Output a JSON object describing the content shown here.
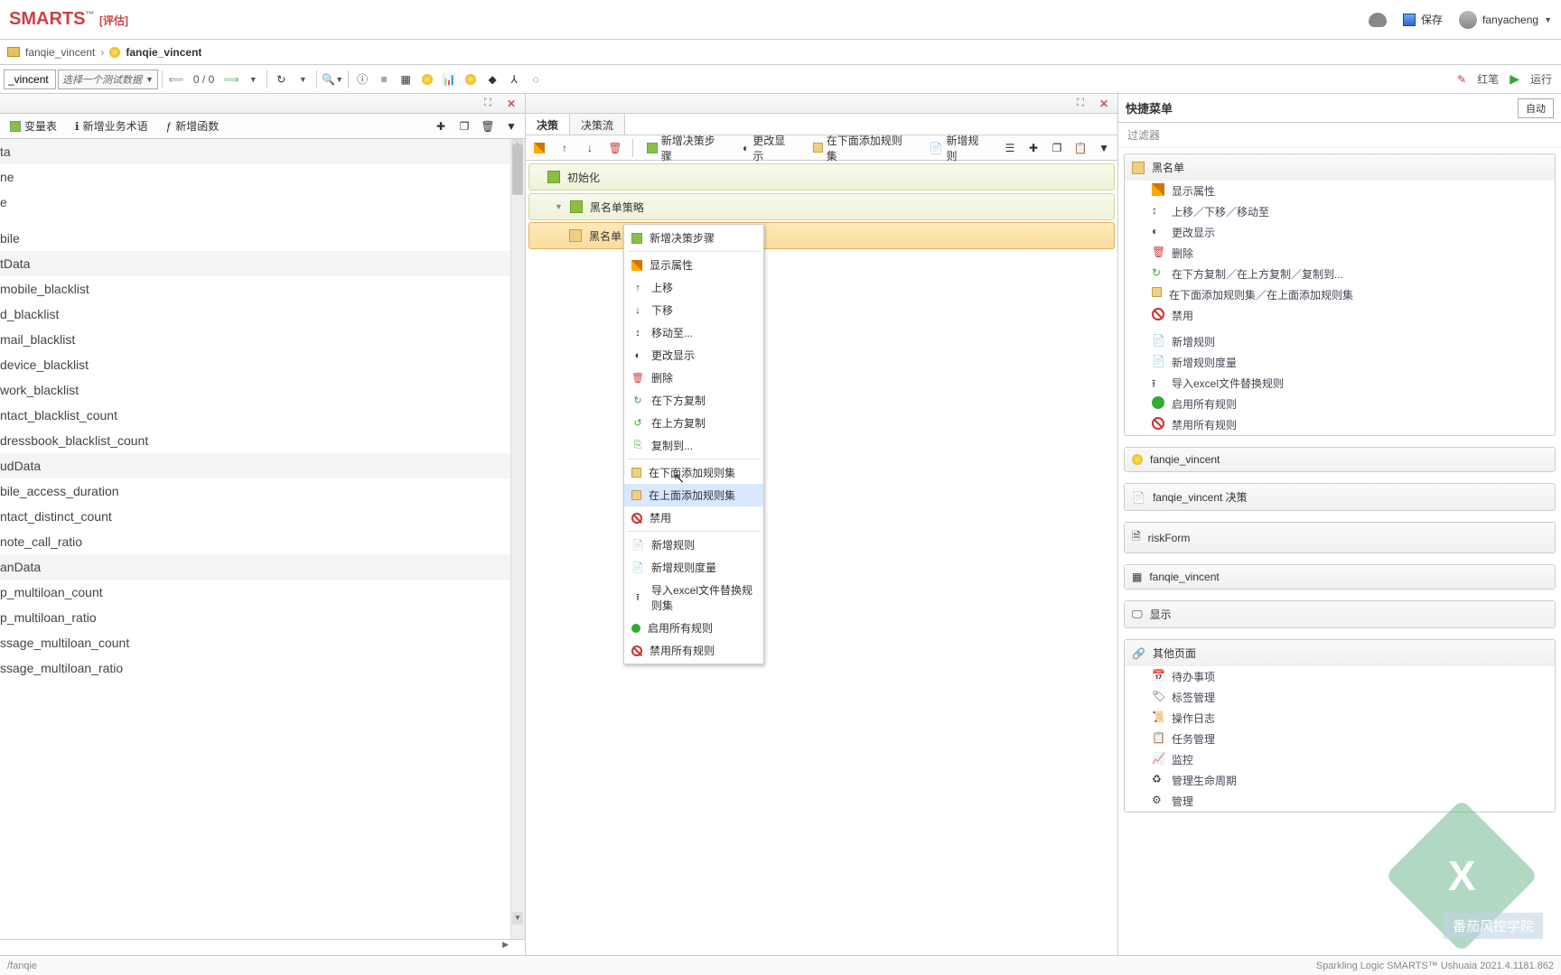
{
  "header": {
    "logo_text": "SMARTS",
    "logo_tm": "™",
    "logo_tag": "[评估]",
    "save_label": "保存",
    "username": "fanyacheng"
  },
  "breadcrumb": {
    "item1": "fanqie_vincent",
    "item2": "fanqie_vincent"
  },
  "toolbar": {
    "input_value": "_vincent",
    "select_placeholder": "选择一个测试数据",
    "pager": "0 / 0",
    "redpen": "红笔",
    "run": "运行"
  },
  "left": {
    "btn_vartable": "变量表",
    "btn_bizrule": "新增业务术语",
    "btn_addfunc": "新增函数",
    "items": [
      {
        "text": "ta",
        "group": true
      },
      {
        "text": "ne",
        "group": false
      },
      {
        "text": "e",
        "group": false
      },
      {
        "text": "",
        "group": false
      },
      {
        "text": "bile",
        "group": false
      },
      {
        "text": "tData",
        "group": true
      },
      {
        "text": "mobile_blacklist",
        "group": false
      },
      {
        "text": "d_blacklist",
        "group": false
      },
      {
        "text": "mail_blacklist",
        "group": false
      },
      {
        "text": "device_blacklist",
        "group": false
      },
      {
        "text": "work_blacklist",
        "group": false
      },
      {
        "text": "ntact_blacklist_count",
        "group": false
      },
      {
        "text": "dressbook_blacklist_count",
        "group": false
      },
      {
        "text": "udData",
        "group": true
      },
      {
        "text": "bile_access_duration",
        "group": false
      },
      {
        "text": "ntact_distinct_count",
        "group": false
      },
      {
        "text": "note_call_ratio",
        "group": false
      },
      {
        "text": "anData",
        "group": true
      },
      {
        "text": "p_multiloan_count",
        "group": false
      },
      {
        "text": "p_multiloan_ratio",
        "group": false
      },
      {
        "text": "ssage_multiloan_count",
        "group": false
      },
      {
        "text": "ssage_multiloan_ratio",
        "group": false
      }
    ]
  },
  "mid": {
    "tab1": "决策",
    "tab2": "决策流",
    "btn_new_step": "新增决策步骤",
    "btn_change_disp": "更改显示",
    "btn_add_ruleset_below": "在下面添加规则集",
    "btn_new_rule": "新增规则",
    "tree": {
      "n1": "初始化",
      "n2": "黑名单策略",
      "n3": "黑名单"
    }
  },
  "ctx": {
    "new_step": "新增决策步骤",
    "show_attr": "显示属性",
    "move_up": "上移",
    "move_down": "下移",
    "move_to": "移动至...",
    "change_disp": "更改显示",
    "delete": "删除",
    "copy_below": "在下方复制",
    "copy_above": "在上方复制",
    "copy_to": "复制到...",
    "add_ruleset_below": "在下面添加规则集",
    "add_ruleset_above": "在上面添加规则集",
    "disable": "禁用",
    "new_rule": "新增规则",
    "new_rule_var": "新增规则度量",
    "import_excel": "导入excel文件替换规则集",
    "enable_all": "启用所有规则",
    "disable_all": "禁用所有规则"
  },
  "right": {
    "title": "快捷菜单",
    "auto": "自动",
    "filter": "过滤器",
    "block1_title": "黑名单",
    "links1": {
      "show_attr": "显示属性",
      "move": "上移／下移／移动至",
      "change_disp": "更改显示",
      "delete": "删除",
      "copy": "在下方复制／在上方复制／复制到...",
      "add_ruleset": "在下面添加规则集／在上面添加规则集",
      "disable": "禁用",
      "new_rule": "新增规则",
      "new_rule_var": "新增规则度量",
      "import_excel": "导入excel文件替换规则",
      "enable_all": "启用所有规则",
      "disable_all": "禁用所有规则"
    },
    "block2": "fanqie_vincent",
    "block3": "fanqie_vincent 决策",
    "block4": "riskForm",
    "block5": "fanqie_vincent",
    "block6": "显示",
    "block7": "其他页面",
    "others": {
      "todo": "待办事项",
      "tag": "标签管理",
      "oplog": "操作日志",
      "task": "任务管理",
      "monitor": "监控",
      "lifecycle": "管理生命周期",
      "mgr": "管理"
    }
  },
  "status": {
    "left": "/fanqie",
    "right": "Sparkling Logic SMARTS™ Ushuaia 2021.4.1181.862"
  },
  "watermark": "番茄风控学院"
}
